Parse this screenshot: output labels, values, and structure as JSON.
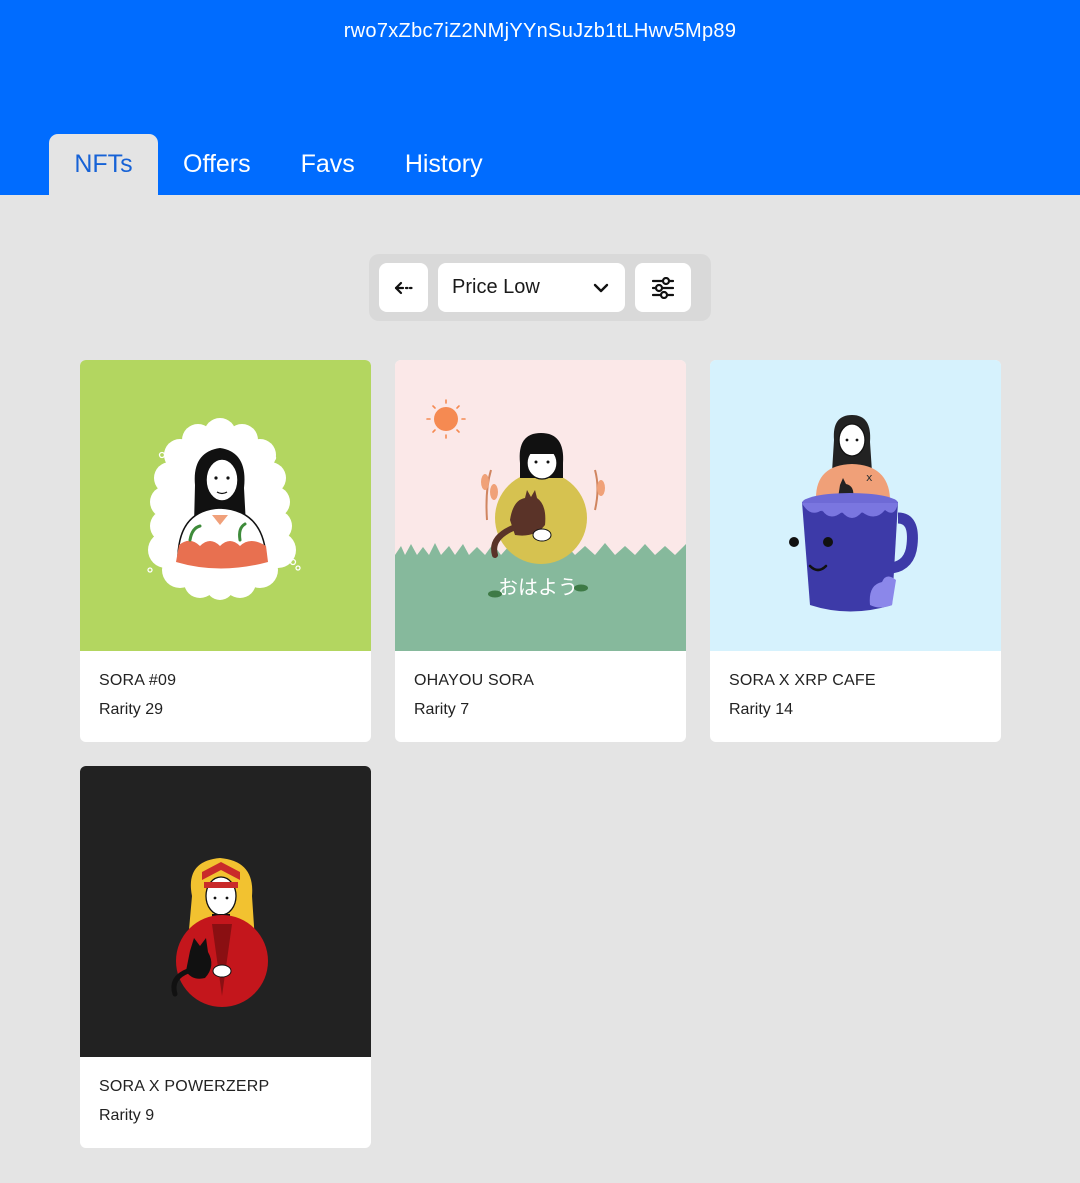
{
  "header": {
    "wallet_address": "rwo7xZbc7iZ2NMjYYnSuJzb1tLHwv5Mp89",
    "background_color": "#006cff"
  },
  "tabs": [
    {
      "label": "NFTs",
      "active": true
    },
    {
      "label": "Offers",
      "active": false
    },
    {
      "label": "Favs",
      "active": false
    },
    {
      "label": "History",
      "active": false
    }
  ],
  "toolbar": {
    "back_icon": "arrow-left-icon",
    "sort": {
      "selected": "Price Low",
      "icon": "chevron-down-icon"
    },
    "filter_icon": "sliders-icon"
  },
  "nfts": [
    {
      "name": "SORA #09",
      "rarity": "Rarity 29",
      "bg_color": "#b3d660"
    },
    {
      "name": "OHAYOU SORA",
      "rarity": "Rarity 7",
      "bg_color": "#fbe8e8",
      "image_text": "おはよう"
    },
    {
      "name": "SORA X XRP CAFE",
      "rarity": "Rarity 14",
      "bg_color": "#d6f2fd"
    },
    {
      "name": "SORA X POWERZERP",
      "rarity": "Rarity 9",
      "bg_color": "#222222"
    }
  ]
}
